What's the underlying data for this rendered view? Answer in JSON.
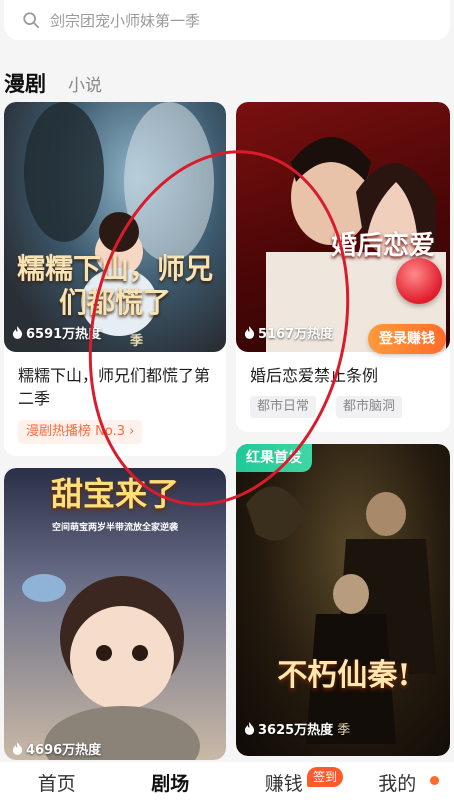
{
  "search": {
    "placeholder": "剑宗团宠小师妹第一季"
  },
  "tabs": {
    "main": "漫剧",
    "secondary": "小说"
  },
  "cards": [
    {
      "poster_title": "糯糯下山，师兄们都慌了",
      "poster_sub": "季",
      "heat": "6591万热度",
      "title": "糯糯下山，师兄们都慌了第二季",
      "rank": "漫剧热播榜 No.3 ›"
    },
    {
      "poster_title": "婚后恋爱",
      "heat": "5167万热度",
      "title": "婚后恋爱禁止条例",
      "tags": [
        "都市日常",
        "都市脑洞"
      ],
      "login_button": "登录赚钱"
    },
    {
      "poster_title": "甜宝来了",
      "poster_sub": "空间萌宝两岁半带流放全家逆袭",
      "heat": "4696万热度"
    },
    {
      "badge": "红果首发",
      "poster_title": "不朽仙秦!",
      "heat": "3625万热度",
      "poster_sub": "季"
    }
  ],
  "nav": [
    {
      "label": "首页"
    },
    {
      "label": "剧场"
    },
    {
      "label": "赚钱"
    },
    {
      "label": "我的"
    }
  ],
  "nav_badge": "签到",
  "colors": {
    "accent": "#ff6a3d",
    "annotation": "#d81c2b",
    "badge_green": "#20c997"
  }
}
